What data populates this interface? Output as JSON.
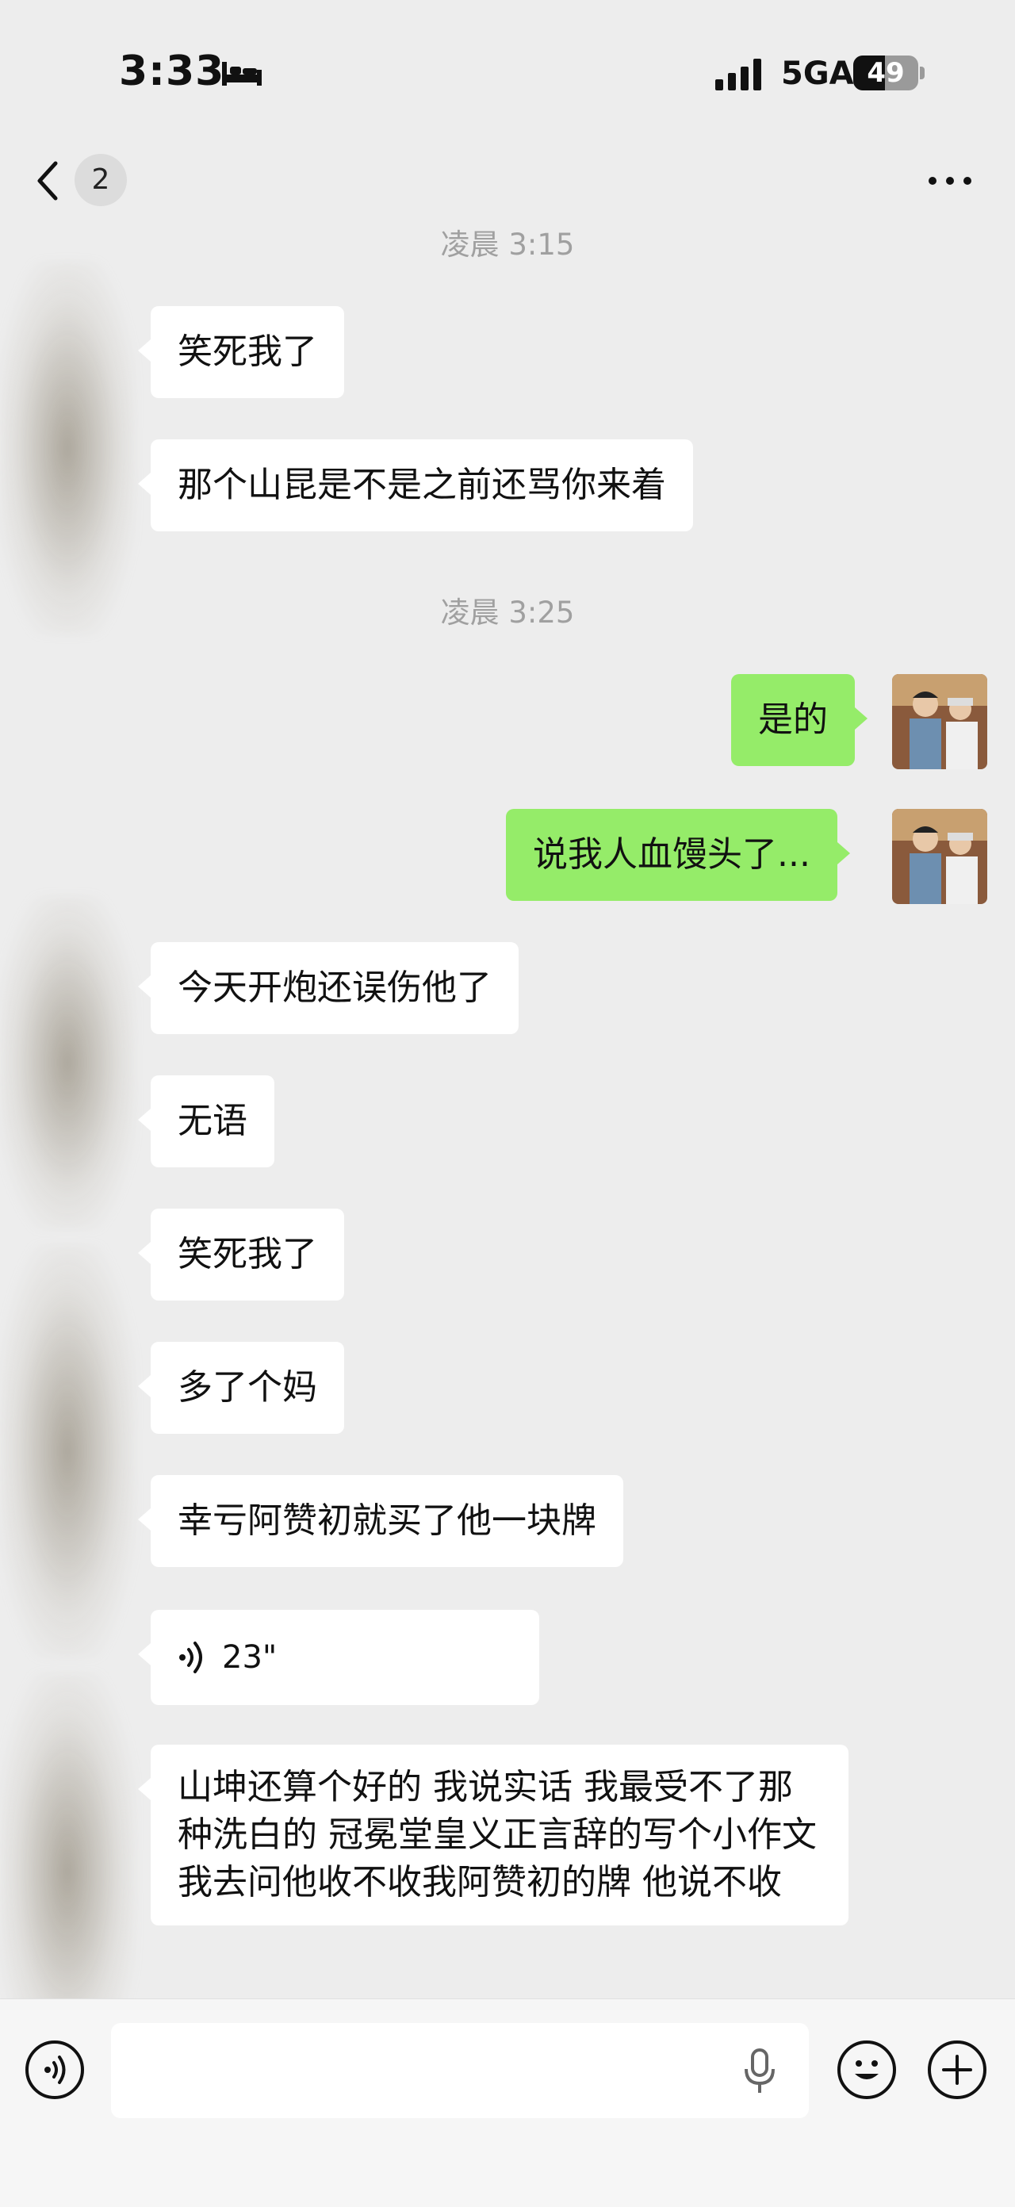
{
  "status_bar": {
    "time": "3:33",
    "network": "5GA",
    "battery": "49",
    "battery_level": 0.49
  },
  "nav": {
    "unread_count": "2"
  },
  "messages": [
    {
      "type": "time",
      "text": "凌晨 3:15"
    },
    {
      "type": "in",
      "text": "笑死我了"
    },
    {
      "type": "in",
      "text": "那个山昆是不是之前还骂你来着"
    },
    {
      "type": "time",
      "text": "凌晨 3:25"
    },
    {
      "type": "out",
      "text": "是的"
    },
    {
      "type": "out",
      "text": "说我人血馒头了..."
    },
    {
      "type": "in",
      "text": "今天开炮还误伤他了"
    },
    {
      "type": "in",
      "text": "无语"
    },
    {
      "type": "in",
      "text": "笑死我了"
    },
    {
      "type": "in",
      "text": "多了个妈"
    },
    {
      "type": "in",
      "text": "幸亏阿赞初就买了他一块牌"
    },
    {
      "type": "voice",
      "duration": "23\""
    },
    {
      "type": "in",
      "text": "山坤还算个好的  我说实话 我最受不了那种洗白的  冠冕堂皇义正言辞的写个小作文 我去问他收不收我阿赞初的牌 他说不收"
    }
  ],
  "colors": {
    "background": "#ededed",
    "incoming_bubble": "#ffffff",
    "outgoing_bubble": "#95ec69",
    "timestamp": "#a0a0a0"
  },
  "icons": [
    "bed-icon",
    "signal-icon",
    "battery-icon",
    "back-icon",
    "more-icon",
    "voice-icon",
    "voice-mode-icon",
    "mic-icon",
    "emoji-icon",
    "plus-icon"
  ]
}
